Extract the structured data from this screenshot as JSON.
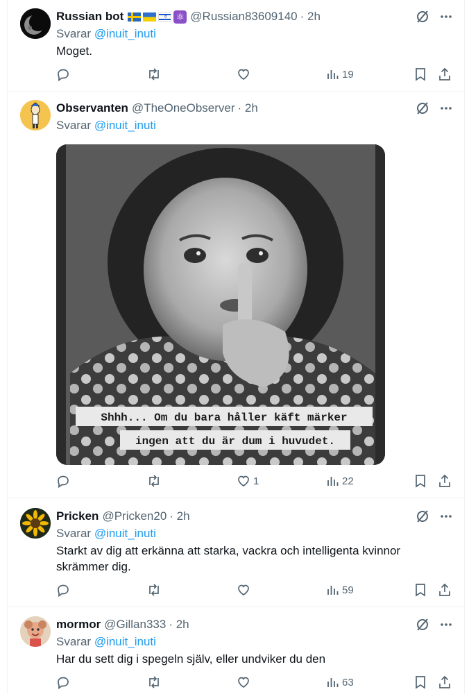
{
  "replies": [
    {
      "display_name": "Russian bot",
      "flag_icons": [
        "sweden-flag-icon",
        "ukraine-flag-icon",
        "israel-flag-icon",
        "atom-icon"
      ],
      "handle": "@Russian83609140",
      "time": "· 2h",
      "reply_prefix": "Svarar",
      "reply_to": "@inuit_inuti",
      "text": "Moget.",
      "likes": "",
      "views": "19"
    },
    {
      "display_name": "Observanten",
      "handle": "@TheOneObserver",
      "time": "· 2h",
      "reply_prefix": "Svarar",
      "reply_to": "@inuit_inuti",
      "media": {
        "caption_line1": "Shhh... Om du bara håller käft märker",
        "caption_line2": "ingen att du är dum i huvudet."
      },
      "likes": "1",
      "views": "22"
    },
    {
      "display_name": "Pricken",
      "handle": "@Pricken20",
      "time": "· 2h",
      "reply_prefix": "Svarar",
      "reply_to": "@inuit_inuti",
      "text": "Starkt av dig att erkänna att starka, vackra och intelligenta kvinnor skrämmer dig.",
      "likes": "",
      "views": "59"
    },
    {
      "display_name": "mormor",
      "handle": "@Gillan333",
      "time": "· 2h",
      "reply_prefix": "Svarar",
      "reply_to": "@inuit_inuti",
      "text": "Har du sett dig i spegeln själv, eller undviker du den",
      "likes": "",
      "views": "63"
    }
  ],
  "colors": {
    "text": "#0f1419",
    "secondary": "#536471",
    "link": "#1d9bf0",
    "divider": "#eff3f4"
  },
  "action_icons": [
    "reply-icon",
    "retweet-icon",
    "like-icon",
    "views-icon",
    "bookmark-icon",
    "share-icon"
  ],
  "header_icons": [
    "grok-icon",
    "more-icon"
  ]
}
